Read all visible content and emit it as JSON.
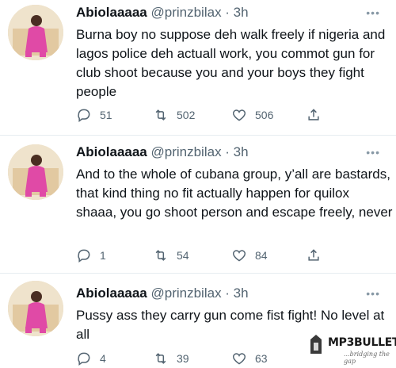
{
  "tweets": [
    {
      "name": "Abiolaaaaa",
      "handle_time": "@prinzbilax · 3h",
      "more": "•••",
      "text": "Burna boy no suppose deh walk freely if nigeria and lagos police deh actuall work, you commot gun for club shoot because you and your boys they fight people",
      "replies": "51",
      "retweets": "502",
      "likes": "506"
    },
    {
      "name": "Abiolaaaaa",
      "handle_time": "@prinzbilax · 3h",
      "more": "•••",
      "text": "And to the whole of cubana group, y’all are bastards, that kind thing no fit actually happen for quilox shaaa, you go shoot person and escape freely, never",
      "replies": "1",
      "retweets": "54",
      "likes": "84"
    },
    {
      "name": "Abiolaaaaa",
      "handle_time": "@prinzbilax · 3h",
      "more": "•••",
      "text": "Pussy ass they carry gun come fist fight! No level at all",
      "replies": "4",
      "retweets": "39",
      "likes": "63"
    }
  ],
  "watermark": {
    "title": "MP3BULLET",
    "tagline": "...bridging the gap"
  },
  "icons": {
    "reply": "reply-icon",
    "retweet": "retweet-icon",
    "like": "heart-icon",
    "share": "share-icon"
  },
  "colors": {
    "text": "#0f1419",
    "muted": "#536471",
    "divider": "#e6ecf0"
  }
}
